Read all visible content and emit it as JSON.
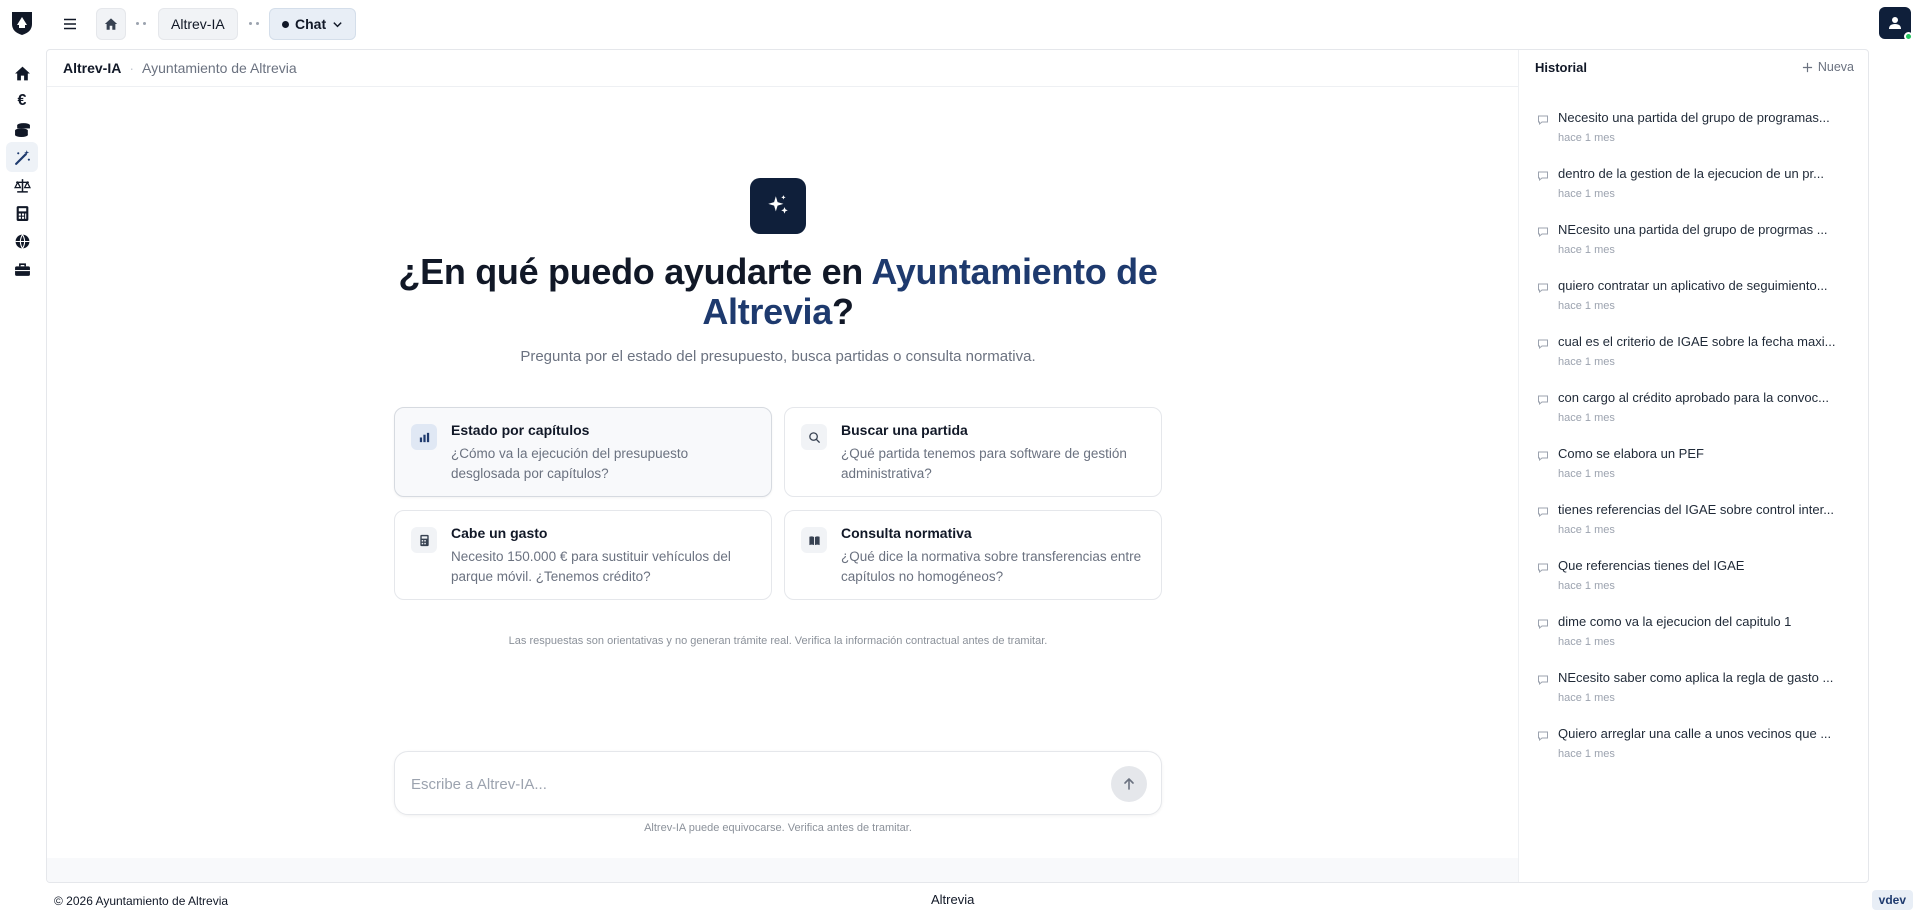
{
  "topbar": {
    "breadcrumb": [
      "Altrev-IA",
      "Chat"
    ]
  },
  "main": {
    "app_name": "Altrev-IA",
    "org_name": "Ayuntamiento de Altrevia",
    "hero_prefix": "¿En qué puedo ayudarte en",
    "hero_accent": "Ayuntamiento de Altrevia",
    "hero_suffix": "?",
    "subtitle": "Pregunta por el estado del presupuesto, busca partidas o consulta normativa.",
    "cards": [
      {
        "title": "Estado por capítulos",
        "desc": "¿Cómo va la ejecución del presupuesto desglosada por capítulos?",
        "icon": "bar-chart-icon"
      },
      {
        "title": "Buscar una partida",
        "desc": "¿Qué partida tenemos para software de gestión administrativa?",
        "icon": "search-icon"
      },
      {
        "title": "Cabe un gasto",
        "desc": "Necesito 150.000 € para sustituir vehículos del parque móvil. ¿Tenemos crédito?",
        "icon": "calculator-icon"
      },
      {
        "title": "Consulta normativa",
        "desc": "¿Qué dice la normativa sobre transferencias entre capítulos no homogéneos?",
        "icon": "book-icon"
      }
    ],
    "disclaimer": "Las respuestas son orientativas y no generan trámite real. Verifica la información contractual antes de tramitar.",
    "composer_placeholder": "Escribe a Altrev-IA...",
    "composer_note": "Altrev-IA puede equivocarse. Verifica antes de tramitar."
  },
  "history": {
    "title": "Historial",
    "new_label": "Nueva",
    "items": [
      {
        "title": "Necesito una partida del grupo de programas...",
        "time": "hace 1 mes"
      },
      {
        "title": "dentro de la gestion de la ejecucion de un pr...",
        "time": "hace 1 mes"
      },
      {
        "title": "NEcesito una partida del grupo de progrmas ...",
        "time": "hace 1 mes"
      },
      {
        "title": "quiero contratar un aplicativo de seguimiento...",
        "time": "hace 1 mes"
      },
      {
        "title": "cual es el criterio de IGAE sobre la fecha maxi...",
        "time": "hace 1 mes"
      },
      {
        "title": "con cargo al crédito aprobado para la convoc...",
        "time": "hace 1 mes"
      },
      {
        "title": "Como se elabora un PEF",
        "time": "hace 1 mes"
      },
      {
        "title": "tienes referencias del IGAE sobre control inter...",
        "time": "hace 1 mes"
      },
      {
        "title": "Que referencias tienes del IGAE",
        "time": "hace 1 mes"
      },
      {
        "title": "dime como va la ejecucion del capitulo 1",
        "time": "hace 1 mes"
      },
      {
        "title": "NEcesito saber como aplica la regla de gasto ...",
        "time": "hace 1 mes"
      },
      {
        "title": "Quiero arreglar una calle a unos vecinos que ...",
        "time": "hace 1 mes"
      }
    ]
  },
  "footer": {
    "copyright": "© 2026 Ayuntamiento de Altrevia",
    "brand": "Altrevia",
    "version": "vdev"
  },
  "colors": {
    "brand_dark": "#0f1f3a",
    "accent": "#1e3a6e",
    "online": "#22c55e"
  },
  "rail_icons": [
    "home-icon",
    "euro-icon",
    "coins-icon",
    "magic-wand-icon",
    "scale-icon",
    "calculator-icon",
    "globe-icon",
    "briefcase-icon"
  ]
}
